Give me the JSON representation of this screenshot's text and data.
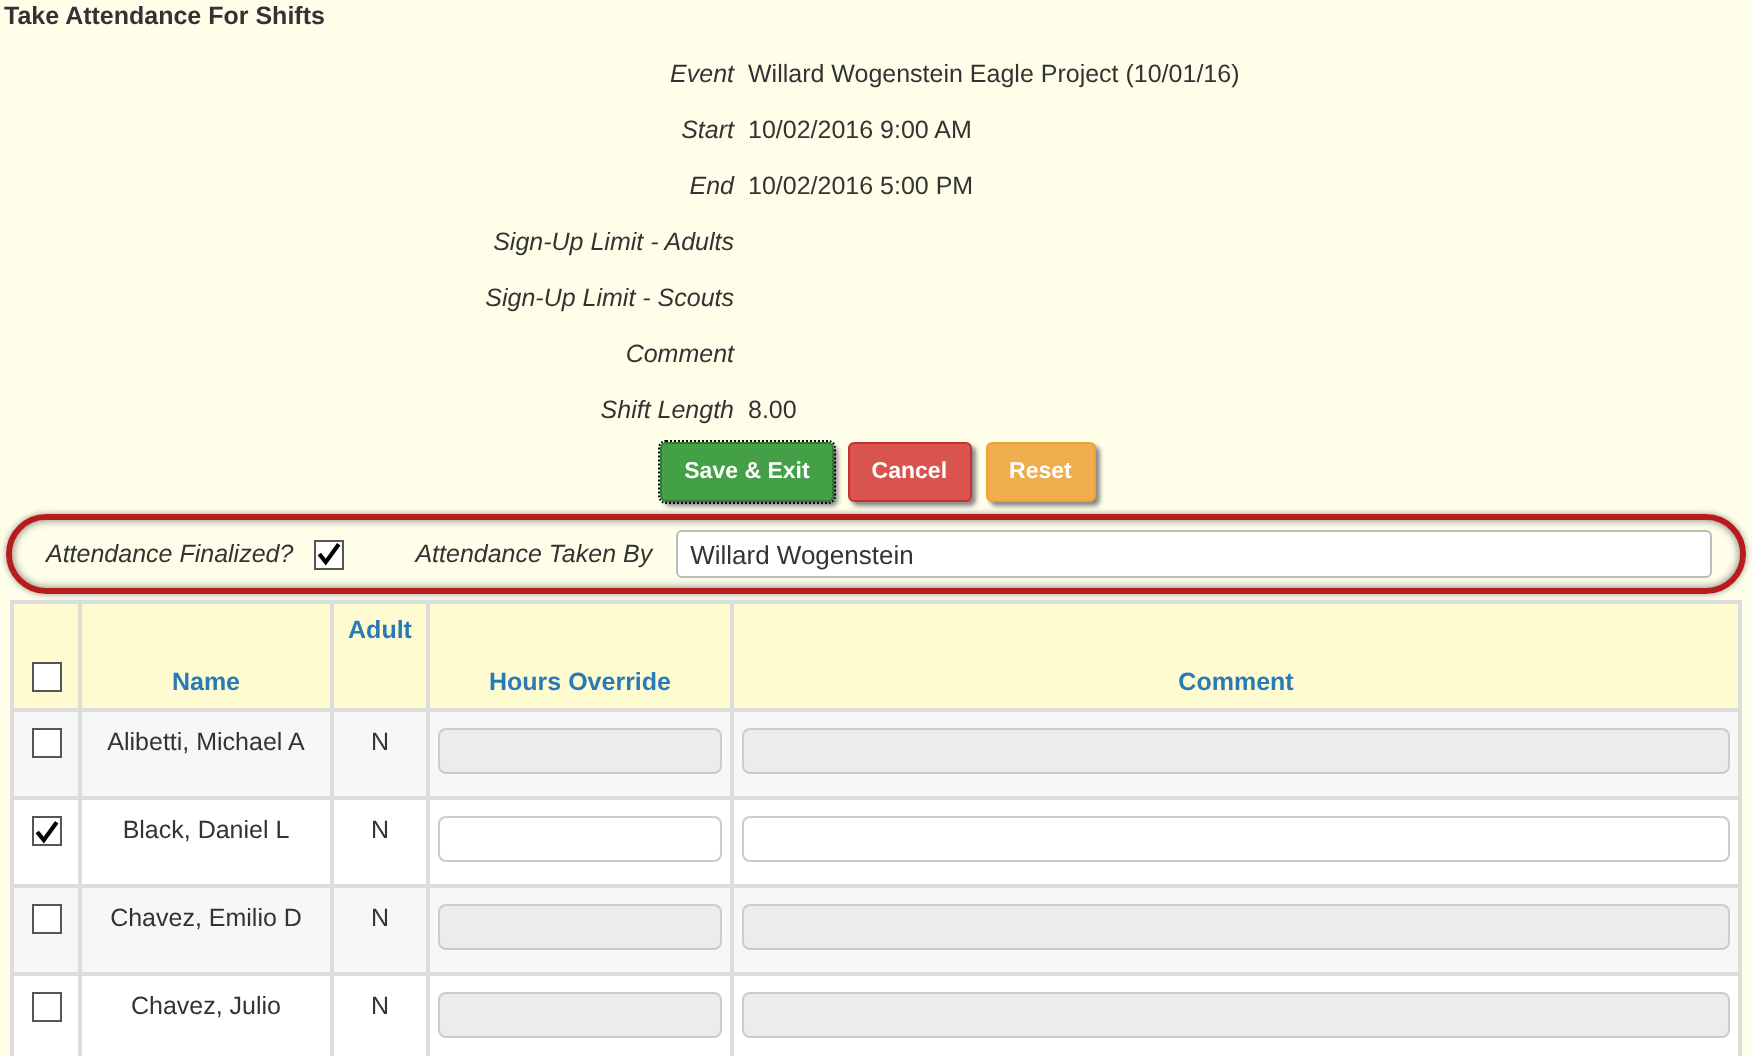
{
  "title": "Take Attendance For Shifts",
  "details": [
    {
      "label": "Event",
      "value": "Willard Wogenstein Eagle Project (10/01/16)"
    },
    {
      "label": "Start",
      "value": "10/02/2016 9:00 AM"
    },
    {
      "label": "End",
      "value": "10/02/2016 5:00 PM"
    },
    {
      "label": "Sign-Up Limit - Adults"
    },
    {
      "label": "Sign-Up Limit - Scouts"
    },
    {
      "label": "Comment"
    },
    {
      "label": "Shift Length",
      "value": "8.00"
    }
  ],
  "buttons": [
    {
      "label": "Save & Exit",
      "kind": "save"
    },
    {
      "label": "Cancel",
      "kind": "cancel"
    },
    {
      "label": "Reset",
      "kind": "reset"
    }
  ],
  "finalized": {
    "label": "Attendance Finalized?",
    "checked": true
  },
  "taken_by": {
    "label": "Attendance Taken By",
    "value": "Willard Wogenstein"
  },
  "table": {
    "select_all_checked": false,
    "columns": [
      "Name",
      "Adult",
      "Hours Override",
      "Comment"
    ],
    "rows": [
      {
        "checked": false,
        "name": "Alibetti, Michael A",
        "adult": "N"
      },
      {
        "checked": true,
        "name": "Black, Daniel L",
        "adult": "N"
      },
      {
        "checked": false,
        "name": "Chavez, Emilio D",
        "adult": "N"
      },
      {
        "checked": false,
        "name": "Chavez, Julio",
        "adult": "N"
      }
    ]
  }
}
